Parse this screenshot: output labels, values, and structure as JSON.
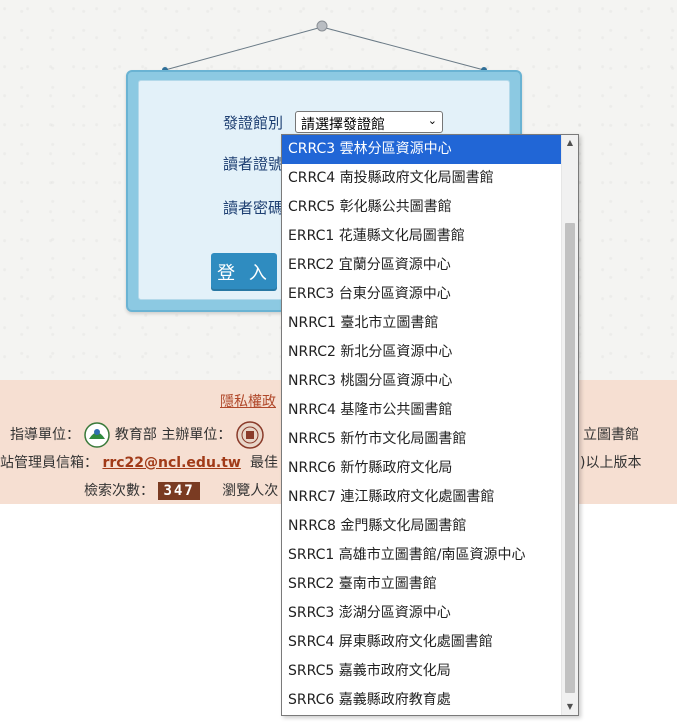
{
  "login": {
    "branch_label": "發證館別",
    "reader_id_label": "讀者證號",
    "password_label": "讀者密碼",
    "branch_select_value": "請選擇發證館",
    "login_button": "登 入"
  },
  "footer": {
    "privacy_link": "隱私權政",
    "guide_label": "指導單位：",
    "moe_name": "教育部",
    "host_label": "主辦單位：",
    "right_fragment_library": "立圖書館",
    "admin_email_label": "站管理員信箱：",
    "admin_email": "rrc22@ncl.edu.tw",
    "browser_hint": "最佳",
    "version_fragment": ")以上版本",
    "search_count_label": "檢索次數：",
    "search_count": "347",
    "visitor_label": "瀏覽人次"
  },
  "dropdown": {
    "options": [
      "CRRC3 雲林分區資源中心",
      "CRRC4 南投縣政府文化局圖書館",
      "CRRC5 彰化縣公共圖書館",
      "ERRC1 花蓮縣文化局圖書館",
      "ERRC2 宜蘭分區資源中心",
      "ERRC3 台東分區資源中心",
      "NRRC1 臺北市立圖書館",
      "NRRC2 新北分區資源中心",
      "NRRC3 桃園分區資源中心",
      "NRRC4 基隆市公共圖書館",
      "NRRC5 新竹市文化局圖書館",
      "NRRC6 新竹縣政府文化局",
      "NRRC7 連江縣政府文化處圖書館",
      "NRRC8 金門縣文化局圖書館",
      "SRRC1 高雄市立圖書館/南區資源中心",
      "SRRC2 臺南市立圖書館",
      "SRRC3 澎湖分區資源中心",
      "SRRC4 屏東縣政府文化處圖書館",
      "SRRC5 嘉義市政府文化局",
      "SRRC6 嘉義縣政府教育處"
    ],
    "selected_index": 0
  },
  "colors": {
    "selected_option": "#2166d6",
    "footer_bg": "#f6dfd2",
    "login_button": "#2f8cc0"
  }
}
